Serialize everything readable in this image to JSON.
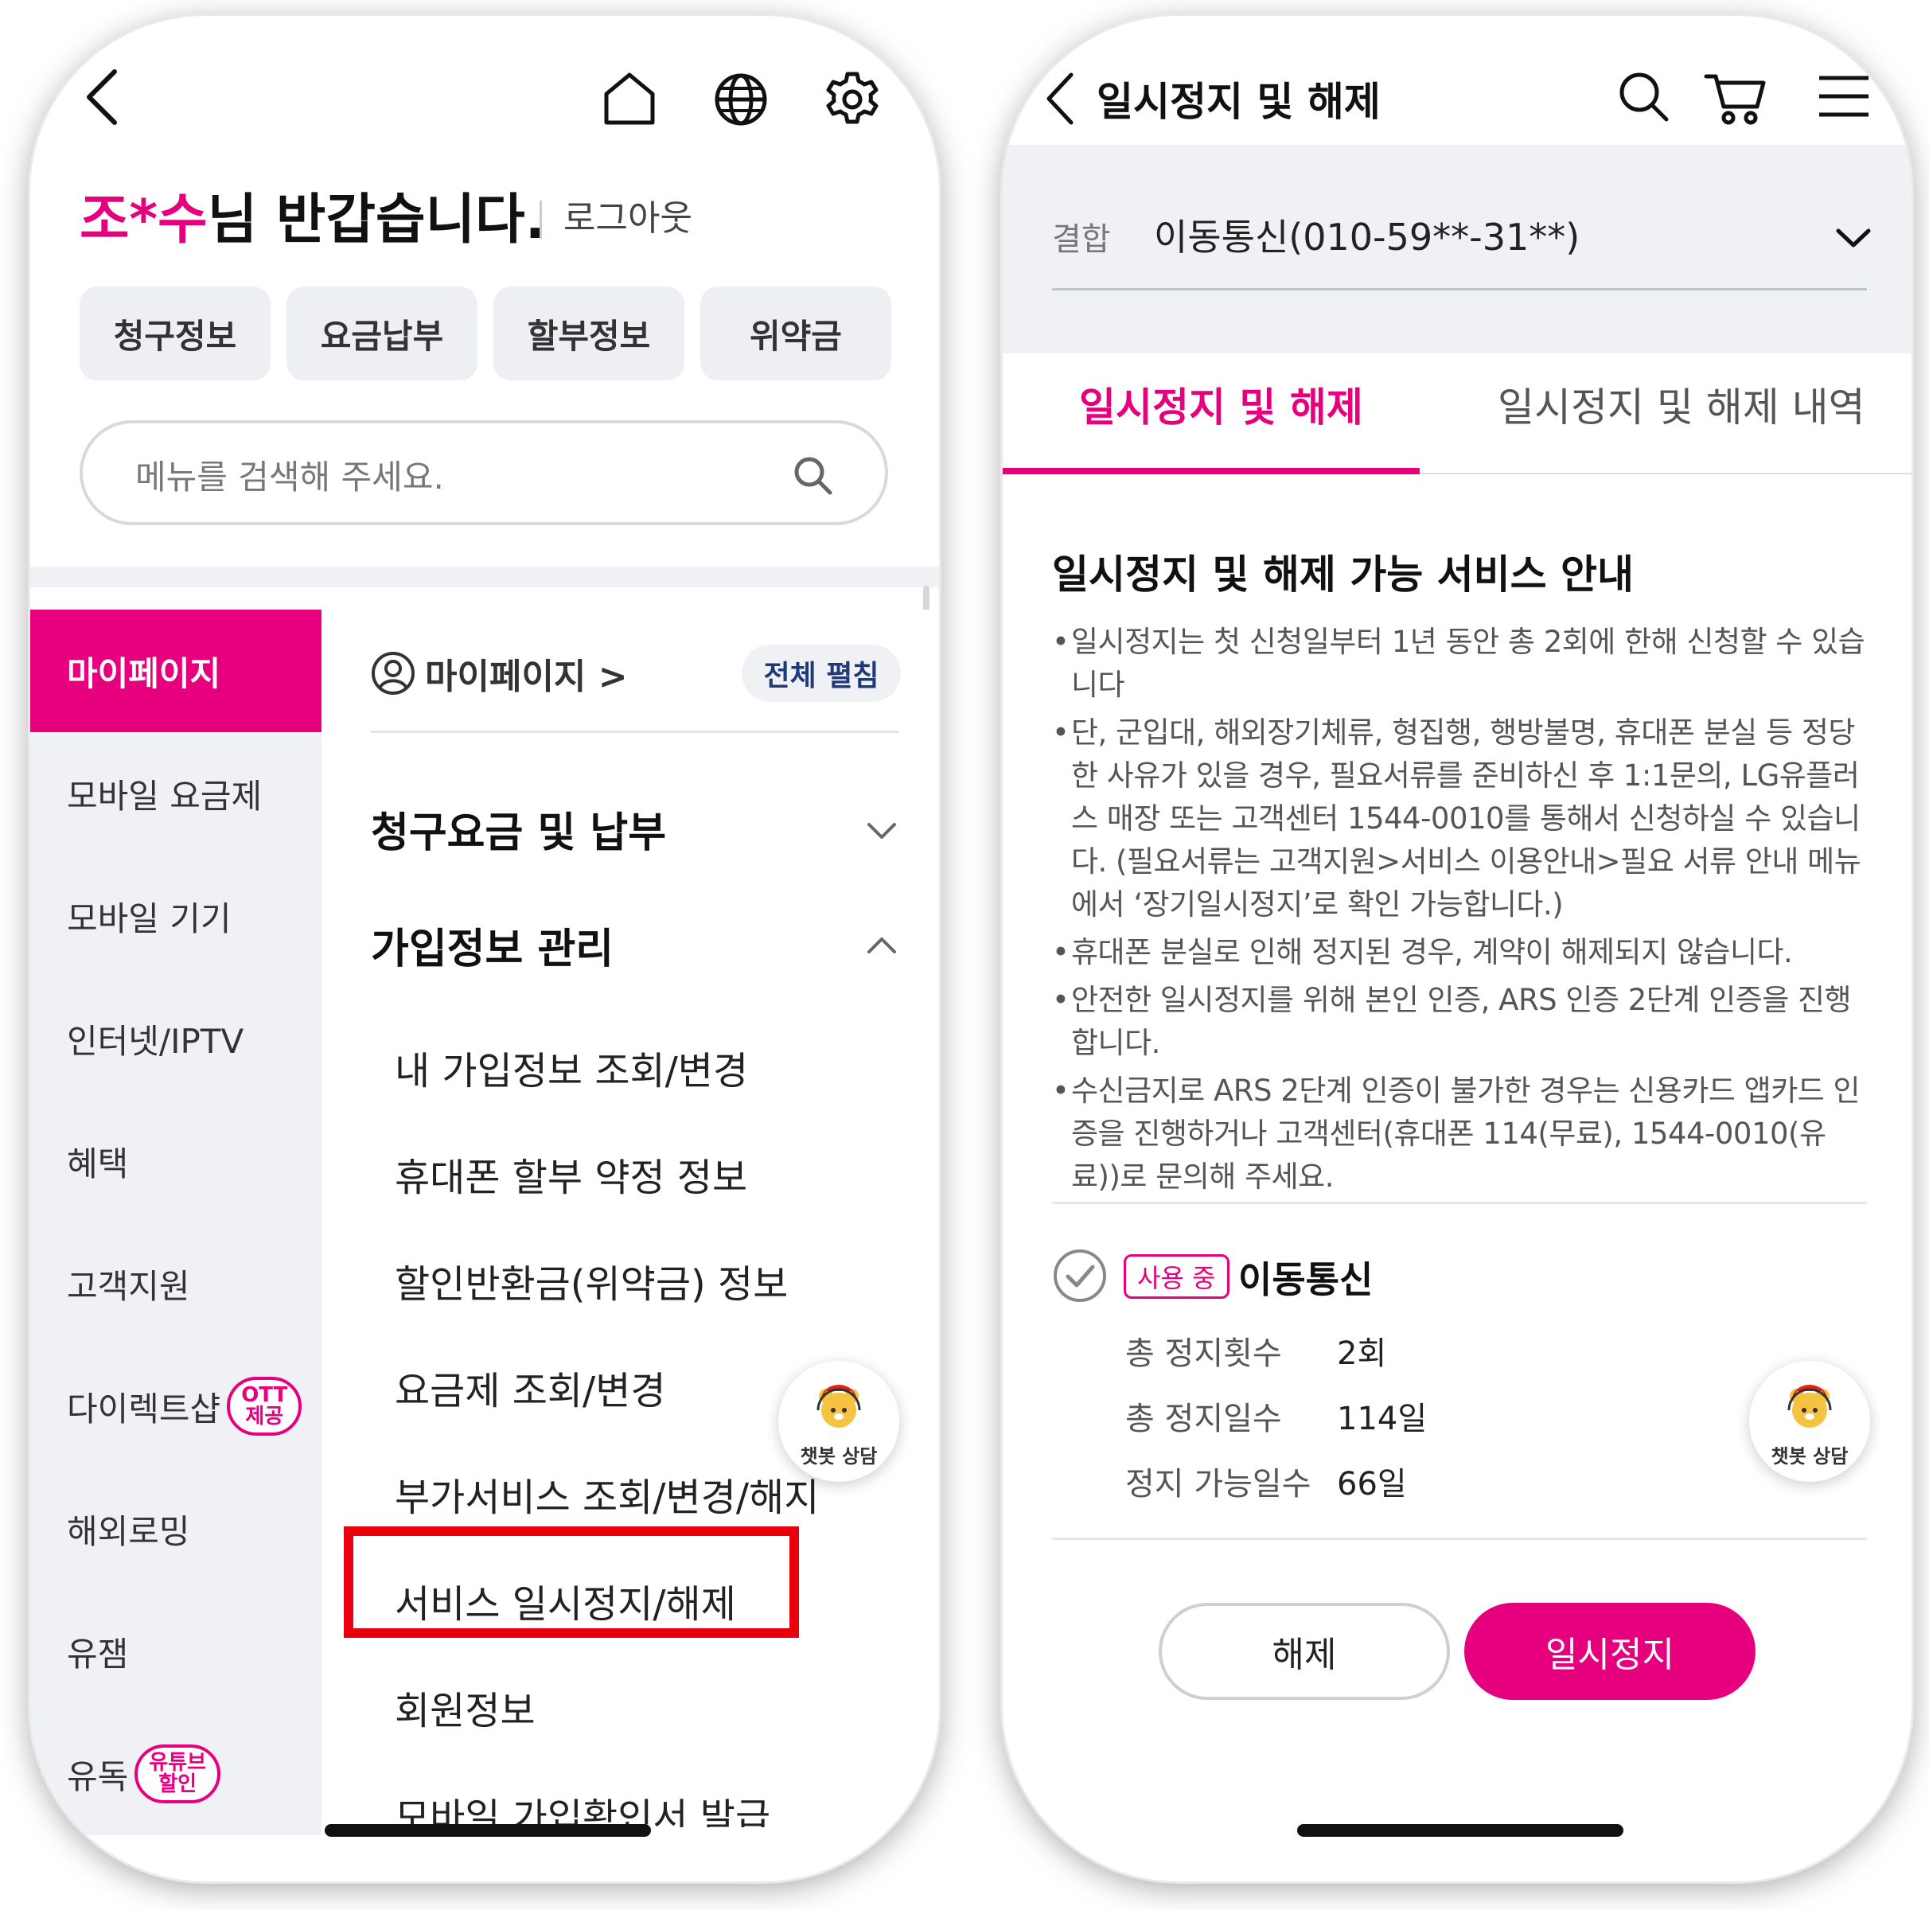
{
  "left": {
    "greeting_name": "조*수",
    "greeting_rest": "님 반갑습니다.",
    "logout": "로그아웃",
    "quick_buttons": [
      "청구정보",
      "요금납부",
      "할부정보",
      "위약금"
    ],
    "search_placeholder": "메뉴를 검색해 주세요.",
    "left_nav": [
      {
        "label": "마이페이지"
      },
      {
        "label": "모바일 요금제"
      },
      {
        "label": "모바일 기기"
      },
      {
        "label": "인터넷/IPTV"
      },
      {
        "label": "혜택"
      },
      {
        "label": "고객지원"
      },
      {
        "label": "다이렉트샵",
        "badge": [
          "OTT",
          "제공"
        ]
      },
      {
        "label": "해외로밍"
      },
      {
        "label": "유잼"
      },
      {
        "label": "유독",
        "badge": [
          "유튜브",
          "할인"
        ]
      }
    ],
    "mypage_link": "마이페이지 >",
    "expand_all": "전체 펼침",
    "sections": [
      {
        "title": "청구요금 및 납부"
      },
      {
        "title": "가입정보 관리"
      }
    ],
    "sub_items": [
      "내 가입정보 조회/변경",
      "휴대폰 할부 약정 정보",
      "할인반환금(위약금) 정보",
      "요금제 조회/변경",
      "부가서비스 조회/변경/해지",
      "서비스 일시정지/해제",
      "회원정보",
      "모바일 가입확인서 발급"
    ],
    "chatbot_label": "챗봇 상담"
  },
  "right": {
    "title": "일시정지 및 해제",
    "selector_label": "결합",
    "selector_value": "이동통신(010-59**-31**)",
    "tabs": [
      "일시정지 및 해제",
      "일시정지 및 해제 내역"
    ],
    "info_title": "일시정지 및 해제 가능 서비스 안내",
    "bullets": [
      "일시정지는 첫 신청일부터 1년 동안 총 2회에 한해 신청할 수 있습니다",
      "단, 군입대, 해외장기체류, 형집행, 행방불명, 휴대폰 분실 등 정당한 사유가 있을 경우, 필요서류를 준비하신 후 1:1문의, LG유플러스 매장 또는 고객센터 1544-0010를 통해서 신청하실 수 있습니다. (필요서류는 고객지원>서비스 이용안내>필요 서류 안내 메뉴에서 ‘장기일시정지’로 확인 가능합니다.)",
      "휴대폰 분실로 인해 정지된 경우, 계약이 해제되지 않습니다.",
      "안전한 일시정지를 위해 본인 인증, ARS 인증 2단계 인증을 진행합니다.",
      "수신금지로 ARS 2단계 인증이 불가한 경우는 신용카드 앱카드 인증을 진행하거나 고객센터(휴대폰 114(무료), 1544-0010(유료))로 문의해 주세요."
    ],
    "status_badge": "사용 중",
    "service_name": "이동통신",
    "stats": [
      {
        "label": "총 정지횟수",
        "value": "2회"
      },
      {
        "label": "총 정지일수",
        "value": "114일"
      },
      {
        "label": "정지 가능일수",
        "value": "66일"
      }
    ],
    "release_button": "해제",
    "pause_button": "일시정지",
    "chatbot_label": "챗봇 상담"
  },
  "colors": {
    "accent": "#e6007e",
    "highlight_box": "#e8000c",
    "nav_bg": "#eff1f5"
  }
}
